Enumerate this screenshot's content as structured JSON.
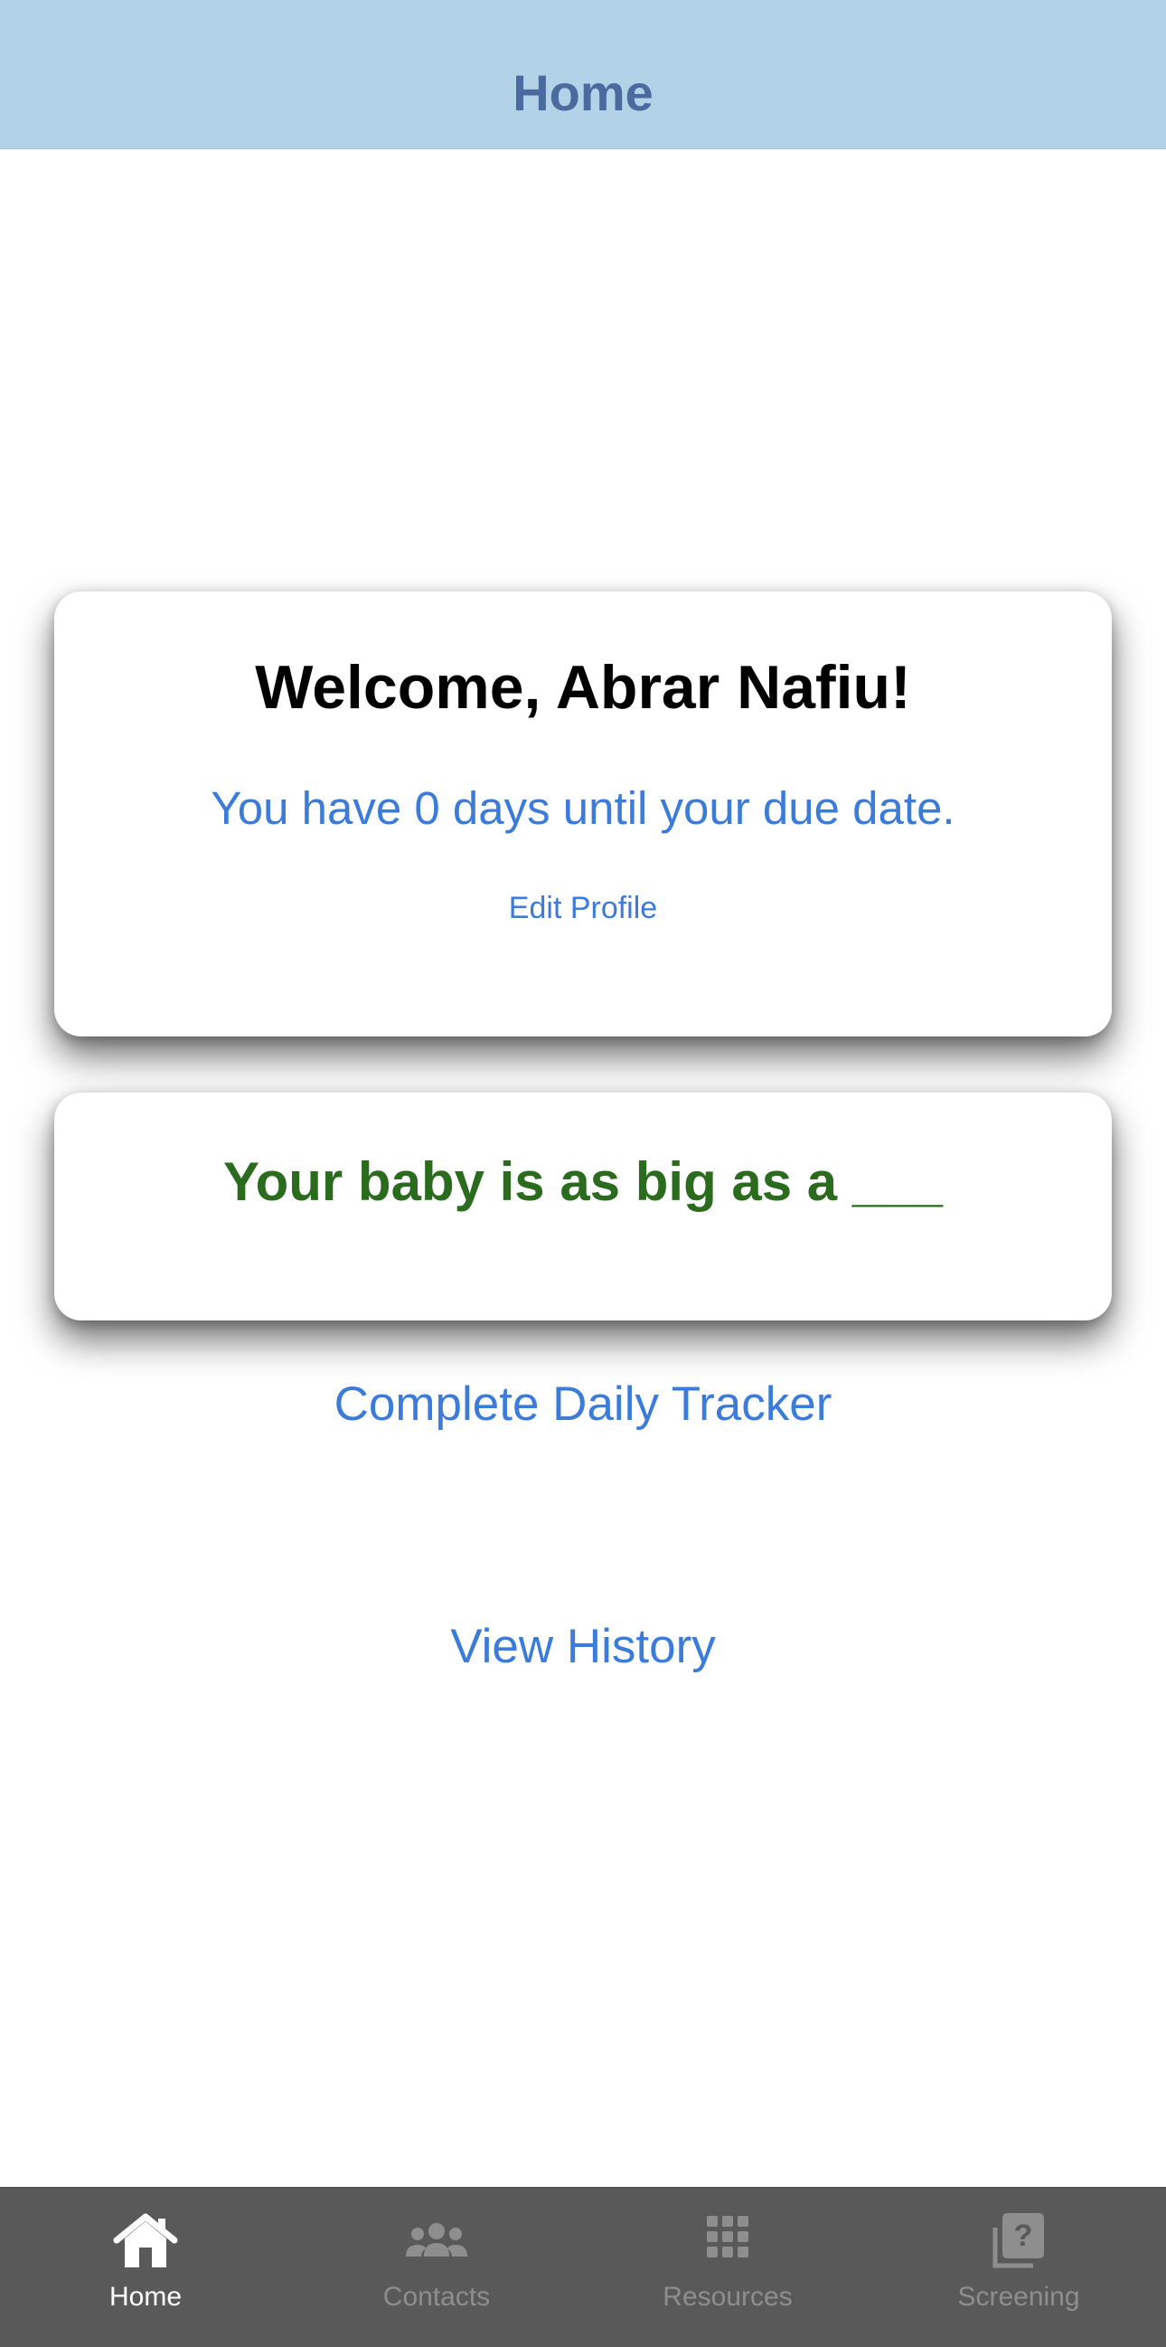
{
  "header": {
    "title": "Home"
  },
  "welcome_card": {
    "title": "Welcome, Abrar Nafiu!",
    "due_text": "You have 0 days until your due date.",
    "edit_profile_label": "Edit Profile"
  },
  "baby_card": {
    "title": "Your baby is as big as a ___"
  },
  "actions": {
    "daily_tracker_label": "Complete Daily Tracker",
    "view_history_label": "View History"
  },
  "tabbar": {
    "active_index": 0,
    "items": [
      {
        "label": "Home",
        "icon": "home-icon"
      },
      {
        "label": "Contacts",
        "icon": "people-icon"
      },
      {
        "label": "Resources",
        "icon": "grid-icon"
      },
      {
        "label": "Screening",
        "icon": "question-stack-icon"
      }
    ]
  },
  "colors": {
    "header_bg": "#b2d2e8",
    "header_text": "#4a6aa0",
    "link_blue": "#3b7bd9",
    "baby_green": "#2a6b1e",
    "tabbar_bg": "#595959",
    "tab_active": "#ffffff",
    "tab_inactive": "#8e8e8e"
  }
}
